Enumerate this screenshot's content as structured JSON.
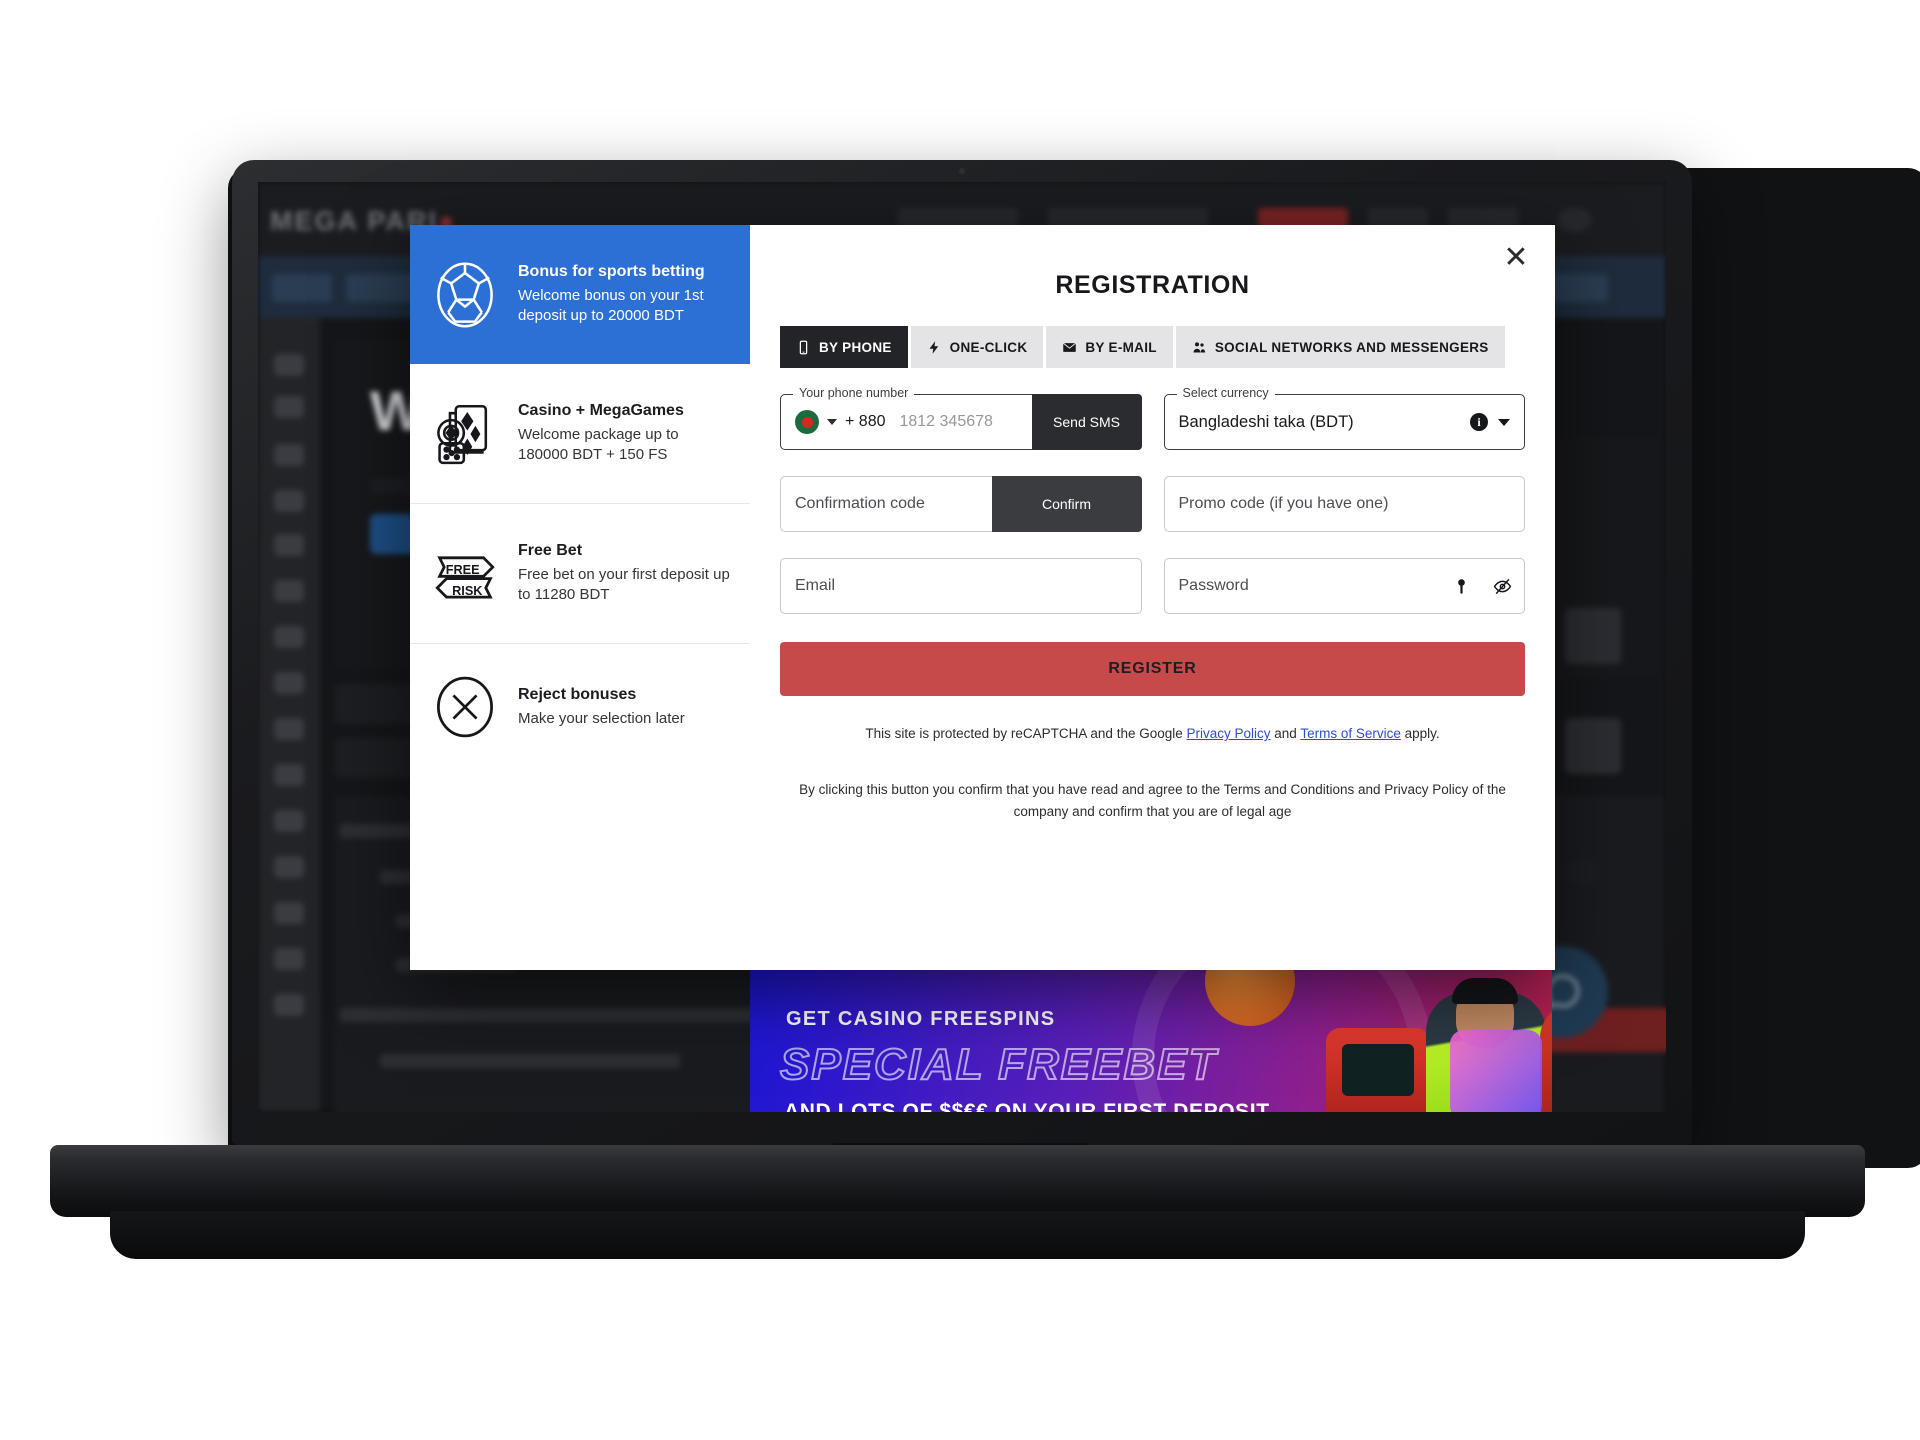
{
  "background_site": {
    "logo": "MEGA PARI",
    "hero_word": "WIN"
  },
  "promo_banner": {
    "line1": "GET CASINO FREESPINS",
    "line2": "SPECIAL FREEBET",
    "line3": "AND LOTS OF $$€€ ON YOUR FIRST DEPOSIT"
  },
  "modal": {
    "title": "REGISTRATION",
    "close_label": "✕",
    "bonuses": [
      {
        "title": "Bonus for sports betting",
        "subtitle": "Welcome bonus on your 1st deposit up to 20000 BDT",
        "icon": "soccer-ball-icon",
        "active": true
      },
      {
        "title": "Casino + MegaGames",
        "subtitle": "Welcome package up to 180000 BDT + 150 FS",
        "icon": "casino-chips-cards-icon",
        "active": false
      },
      {
        "title": "Free Bet",
        "subtitle": "Free bet on your first deposit up to 11280 BDT",
        "icon": "free-risk-ribbon-icon",
        "active": false
      },
      {
        "title": "Reject bonuses",
        "subtitle": "Make your selection later",
        "icon": "circle-x-icon",
        "active": false
      }
    ],
    "tabs": [
      {
        "label": "BY PHONE",
        "icon": "phone-icon",
        "active": true
      },
      {
        "label": "ONE-CLICK",
        "icon": "lightning-icon",
        "active": false
      },
      {
        "label": "BY E-MAIL",
        "icon": "envelope-icon",
        "active": false
      },
      {
        "label": "SOCIAL NETWORKS AND MESSENGERS",
        "icon": "people-icon",
        "active": false
      }
    ],
    "form": {
      "phone_label": "Your phone number",
      "phone_dialcode": "+ 880",
      "phone_placeholder": "1812 345678",
      "send_sms_label": "Send SMS",
      "currency_label": "Select currency",
      "currency_value": "Bangladeshi taka (BDT)",
      "currency_info_icon": "info-icon",
      "confirmation_placeholder": "Confirmation code",
      "confirm_label": "Confirm",
      "promo_placeholder": "Promo code (if you have one)",
      "email_placeholder": "Email",
      "password_placeholder": "Password",
      "password_key_icon": "key-icon",
      "password_eye_icon": "eye-off-icon",
      "register_label": "REGISTER"
    },
    "legal": {
      "recaptcha_pre": "This site is protected by reCAPTCHA and the Google ",
      "recaptcha_link1": "Privacy Policy",
      "recaptcha_mid": " and ",
      "recaptcha_link2": "Terms of Service",
      "recaptcha_post": " apply.",
      "terms_pre": "By clicking this button you confirm that you have read and agree to the ",
      "terms_link1": "Terms and Conditions",
      "terms_mid": " and ",
      "terms_link2": "Privacy Policy",
      "terms_post": " of the company and confirm that you are of legal age"
    }
  },
  "colors": {
    "accent_blue": "#2c70d6",
    "register_red": "#c74a4a",
    "dark": "#232427",
    "link_blue": "#2c4bd6"
  }
}
